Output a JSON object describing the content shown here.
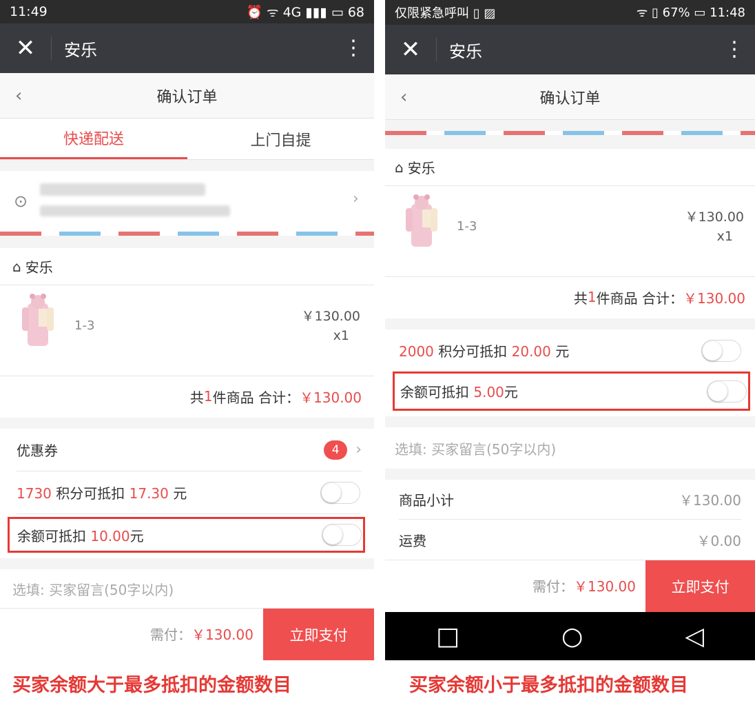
{
  "left": {
    "status": {
      "time": "11:49",
      "right": "⏰ ᯤ 4G ▮▮▮ ▭ 68"
    },
    "titlebar": {
      "close": "✕",
      "title": "安乐",
      "more": "⋮"
    },
    "nav": {
      "back": "‹",
      "title": "确认订单"
    },
    "tabs": [
      "快递配送",
      "上门自提"
    ],
    "shop": {
      "icon": "⌂",
      "name": "安乐"
    },
    "product": {
      "spec": "1-3",
      "price": "￥130.00",
      "qty": "x1"
    },
    "summary": {
      "prefix": "共 ",
      "count": "1",
      "mid": " 件商品 合计：",
      "total": "￥130.00"
    },
    "coupon": {
      "label": "优惠券",
      "count": "4"
    },
    "points": {
      "points": "1730",
      "text": " 积分可抵扣 ",
      "amount": "17.30",
      "unit": " 元"
    },
    "balance": {
      "label": "余额可抵扣 ",
      "amount": "10.00",
      "unit": "元"
    },
    "message_placeholder": "选填: 买家留言(50字以内)",
    "footer": {
      "need_label": "需付：",
      "need_amount": "￥130.00",
      "pay": "立即支付"
    }
  },
  "right": {
    "status": {
      "left": "仅限紧急呼叫 ▯ ▨",
      "right": "ᯤ ▯ 67% ▭ 11:48"
    },
    "titlebar": {
      "close": "✕",
      "title": "安乐",
      "more": "⋮"
    },
    "nav": {
      "back": "‹",
      "title": "确认订单"
    },
    "shop": {
      "icon": "⌂",
      "name": "安乐"
    },
    "product": {
      "spec": "1-3",
      "price": "￥130.00",
      "qty": "x1"
    },
    "summary": {
      "prefix": "共 ",
      "count": "1",
      "mid": " 件商品 合计：",
      "total": "￥130.00"
    },
    "points": {
      "points": "2000",
      "text": " 积分可抵扣 ",
      "amount": "20.00",
      "unit": " 元"
    },
    "balance": {
      "label": "余额可抵扣 ",
      "amount": "5.00",
      "unit": "元"
    },
    "message_placeholder": "选填: 买家留言(50字以内)",
    "subtotal": {
      "label": "商品小计",
      "value": "￥130.00"
    },
    "shipping": {
      "label": "运费",
      "value": "￥0.00"
    },
    "footer": {
      "need_label": "需付：",
      "need_amount": "￥130.00",
      "pay": "立即支付"
    },
    "androidnav": {
      "square": "□",
      "circle": "○",
      "back": "◁"
    }
  },
  "captions": {
    "left": "买家余额大于最多抵扣的金额数目",
    "right": "买家余额小于最多抵扣的金额数目"
  }
}
